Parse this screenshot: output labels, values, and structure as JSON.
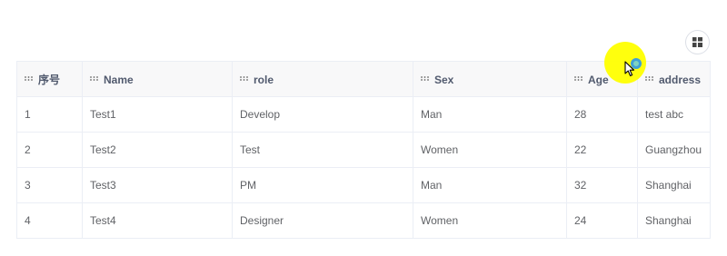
{
  "toolbar": {
    "layout_icon": "grid-layout-icon"
  },
  "table": {
    "columns": [
      {
        "label": "序号"
      },
      {
        "label": "Name"
      },
      {
        "label": "role"
      },
      {
        "label": "Sex"
      },
      {
        "label": "Age"
      },
      {
        "label": "address"
      }
    ],
    "rows": [
      [
        "1",
        "Test1",
        "Develop",
        "Man",
        "28",
        "test abc"
      ],
      [
        "2",
        "Test2",
        "Test",
        "Women",
        "22",
        "Guangzhou"
      ],
      [
        "3",
        "Test3",
        "PM",
        "Man",
        "32",
        "Shanghai"
      ],
      [
        "4",
        "Test4",
        "Designer",
        "Women",
        "24",
        "Shanghai"
      ]
    ]
  },
  "colors": {
    "header_bg": "#f8f8f9",
    "border": "#ebeef5",
    "cursor_highlight": "#ffff00"
  }
}
